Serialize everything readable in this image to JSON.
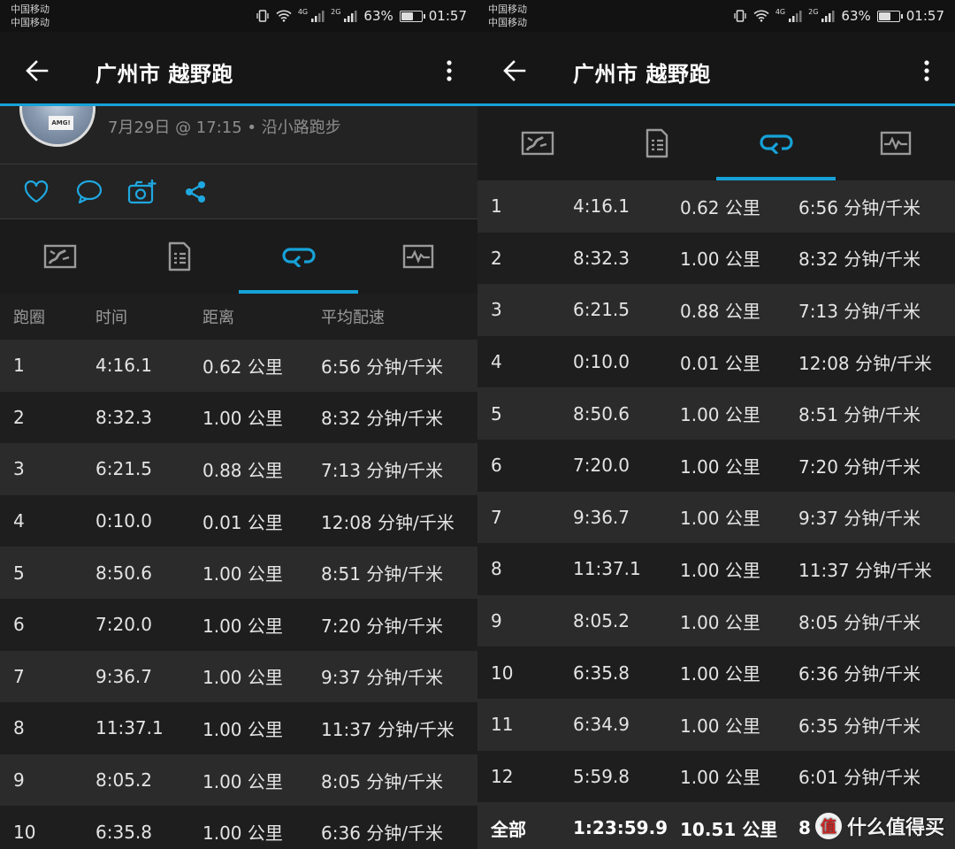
{
  "status_bar": {
    "carrier_1": "中国移动",
    "carrier_2": "中国移动",
    "net_1": "4G",
    "net_2": "2G",
    "battery": "63%",
    "battery_level": 0.63,
    "time": "01:57"
  },
  "toolbar": {
    "title": "广州市 越野跑",
    "back_icon": "arrow-left-icon",
    "more_icon": "more-vertical-icon"
  },
  "activity": {
    "meta": "7月29日 @ 17:15 • 沿小路跑步",
    "bib_text": "AMG!"
  },
  "actions": {
    "icons": [
      "heart-icon",
      "comment-icon",
      "add-photo-icon",
      "share-icon"
    ]
  },
  "tabs": [
    {
      "icon": "map-icon",
      "active": false
    },
    {
      "icon": "details-icon",
      "active": false
    },
    {
      "icon": "laps-icon",
      "active": true
    },
    {
      "icon": "chart-icon",
      "active": false
    }
  ],
  "colors": {
    "accent": "#16a2d8",
    "background": "#1e1e1e",
    "row_alt": "#2b2b2b",
    "toolbar": "#161616"
  },
  "table": {
    "headers": [
      "跑圈",
      "时间",
      "距离",
      "平均配速"
    ],
    "laps": [
      {
        "lap": "1",
        "time": "4:16.1",
        "distance": "0.62 公里",
        "pace": "6:56 分钟/千米"
      },
      {
        "lap": "2",
        "time": "8:32.3",
        "distance": "1.00 公里",
        "pace": "8:32 分钟/千米"
      },
      {
        "lap": "3",
        "time": "6:21.5",
        "distance": "0.88 公里",
        "pace": "7:13 分钟/千米"
      },
      {
        "lap": "4",
        "time": "0:10.0",
        "distance": "0.01 公里",
        "pace": "12:08 分钟/千米"
      },
      {
        "lap": "5",
        "time": "8:50.6",
        "distance": "1.00 公里",
        "pace": "8:51 分钟/千米"
      },
      {
        "lap": "6",
        "time": "7:20.0",
        "distance": "1.00 公里",
        "pace": "7:20 分钟/千米"
      },
      {
        "lap": "7",
        "time": "9:36.7",
        "distance": "1.00 公里",
        "pace": "9:37 分钟/千米"
      },
      {
        "lap": "8",
        "time": "11:37.1",
        "distance": "1.00 公里",
        "pace": "11:37 分钟/千米"
      },
      {
        "lap": "9",
        "time": "8:05.2",
        "distance": "1.00 公里",
        "pace": "8:05 分钟/千米"
      },
      {
        "lap": "10",
        "time": "6:35.8",
        "distance": "1.00 公里",
        "pace": "6:36 分钟/千米"
      },
      {
        "lap": "11",
        "time": "6:34.9",
        "distance": "1.00 公里",
        "pace": "6:35 分钟/千米"
      },
      {
        "lap": "12",
        "time": "5:59.8",
        "distance": "1.00 公里",
        "pace": "6:01 分钟/千米"
      }
    ],
    "total": {
      "lap": "全部",
      "time": "1:23:59.9",
      "distance": "10.51 公里",
      "pace": "8"
    }
  },
  "watermark": {
    "logo": "值",
    "text": "什么值得买"
  }
}
